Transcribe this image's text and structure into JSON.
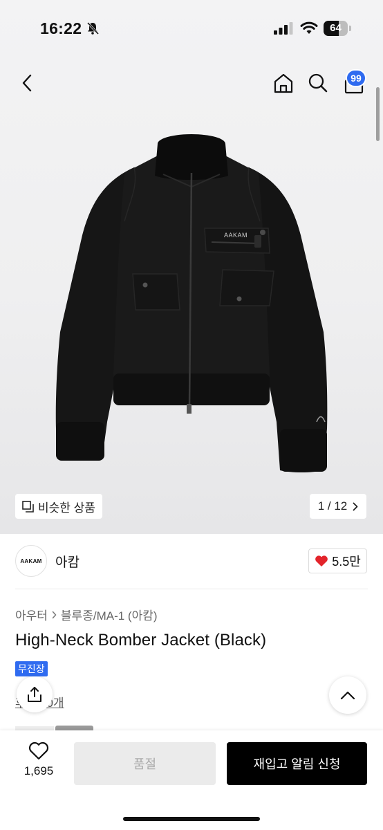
{
  "status_bar": {
    "time": "16:22",
    "battery_level": 64,
    "battery_text": "64"
  },
  "header": {
    "cart_count": "99"
  },
  "gallery": {
    "image_brand_text": "AAKAM",
    "similar_label": "비슷한 상품",
    "counter": "1 / 12"
  },
  "brand": {
    "logo_text": "AAKAM",
    "name": "아캄",
    "likes": "5.5만"
  },
  "product": {
    "breadcrumb": [
      "아우터",
      "블루종/MA-1 (아캄)"
    ],
    "title": "High-Neck Bomber Jacket (Black)",
    "badge": "무진장",
    "review_link": "후기 10개"
  },
  "bottom_bar": {
    "wish_count": "1,695",
    "soldout_label": "품절",
    "restock_label": "재입고 알림 신청"
  },
  "colors": {
    "accent_blue": "#2f6bf0",
    "heart_red": "#e3242b",
    "button_black": "#000000"
  },
  "icons": [
    "back-icon",
    "home-icon",
    "search-icon",
    "cart-icon",
    "share-icon",
    "chevron-up-icon",
    "heart-icon",
    "similar-icon"
  ]
}
